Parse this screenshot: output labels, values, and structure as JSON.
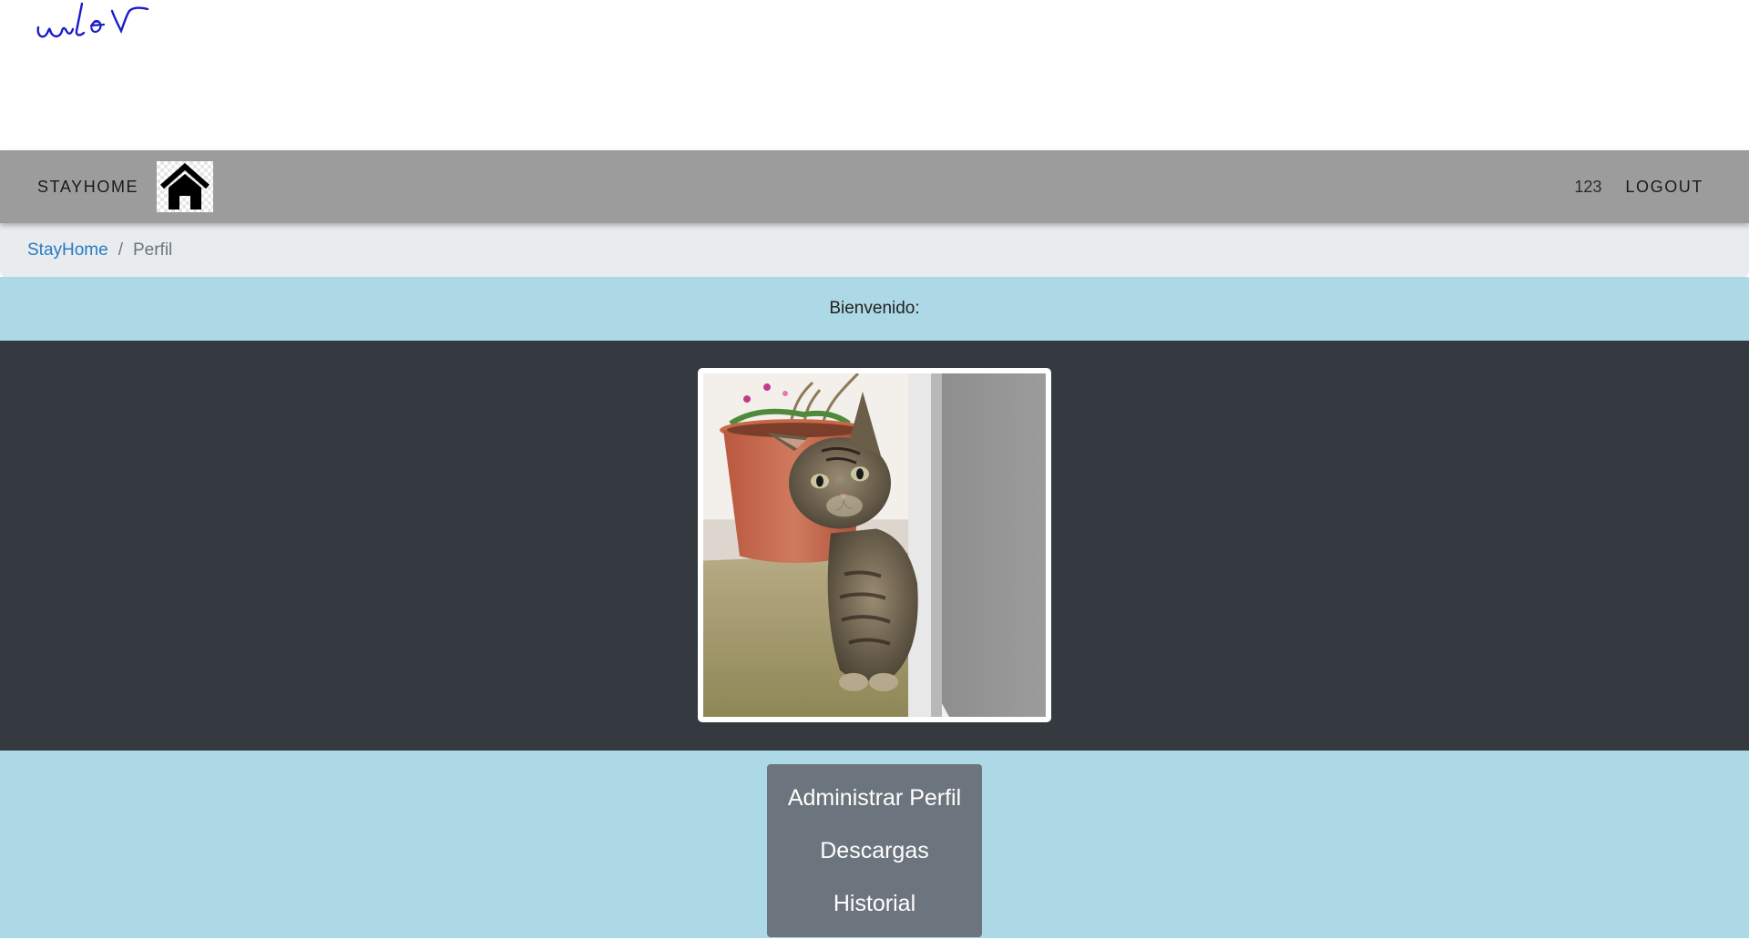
{
  "header": {
    "brand": "STAYHOME",
    "user": "123",
    "logout": "LOGOUT"
  },
  "breadcrumb": {
    "home": "StayHome",
    "separator": "/",
    "current": "Perfil"
  },
  "welcome": {
    "text": "Bienvenido:"
  },
  "profile": {
    "photo": "kitten-photo"
  },
  "menu": {
    "items": [
      {
        "label": "Administrar Perfil"
      },
      {
        "label": "Descargas"
      },
      {
        "label": "Historial"
      }
    ]
  },
  "colors": {
    "navbar": "#9c9c9c",
    "breadcrumb_bg": "#e9ecef",
    "link": "#2a7ac0",
    "light_blue": "#add8e6",
    "dark_section": "#343a40",
    "menu_bg": "#6c757d",
    "scribble": "#1c1cc8"
  }
}
